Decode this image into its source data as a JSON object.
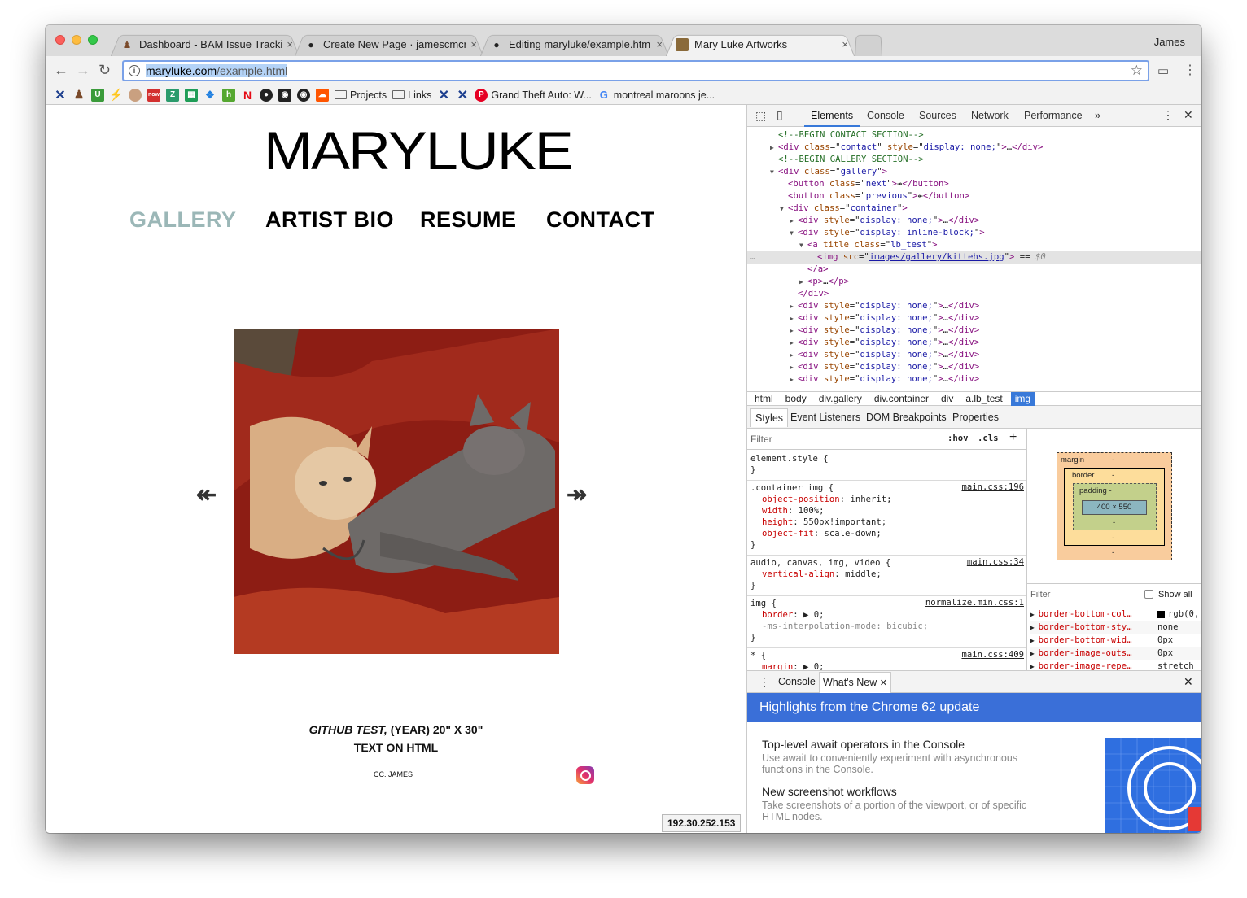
{
  "browser": {
    "user": "James",
    "tabs": [
      {
        "title": "Dashboard - BAM Issue Tracki",
        "close": "×"
      },
      {
        "title": "Create New Page · jamescmcr",
        "close": "×"
      },
      {
        "title": "Editing maryluke/example.html",
        "close": "×"
      },
      {
        "title": "Mary Luke Artworks",
        "close": "×"
      }
    ],
    "url_host": "maryluke.com",
    "url_path": "/example.html",
    "bookmarks": [
      {
        "label": "Projects"
      },
      {
        "label": "Links"
      },
      {
        "label": "Grand Theft Auto: W..."
      },
      {
        "label": "montreal maroons je..."
      }
    ]
  },
  "site": {
    "logo": "MARYLUKE",
    "nav": [
      "GALLERY",
      "ARTIST BIO",
      "RESUME",
      "CONTACT"
    ],
    "active_nav": "GALLERY",
    "active_color": "#9bb7b7",
    "prev_arrow": "↞",
    "next_arrow": "↠",
    "caption_title": "GITHUB TEST,",
    "caption_rest": " (YEAR) 20\" X 30\"",
    "caption_medium": "TEXT ON HTML",
    "credit": "CC. JAMES",
    "status_ip": "192.30.252.153"
  },
  "devtools": {
    "tabs": [
      "Elements",
      "Console",
      "Sources",
      "Network",
      "Performance",
      "»"
    ],
    "dom_lines": [
      {
        "indent": 2,
        "tri": "",
        "html": "<span class='cm'>&lt;!--BEGIN CONTACT SECTION--&gt;</span>"
      },
      {
        "indent": 2,
        "tri": "▶",
        "html": "<span class='tg'>&lt;div</span> <span class='at'>class</span>=\"<span class='av'>contact</span>\" <span class='at'>style</span>=\"<span class='av'>display: none;</span>\"<span class='tg'>&gt;</span>…<span class='tg'>&lt;/div&gt;</span>"
      },
      {
        "indent": 2,
        "tri": "",
        "html": "<span class='cm'>&lt;!--BEGIN GALLERY SECTION--&gt;</span>"
      },
      {
        "indent": 2,
        "tri": "▼",
        "html": "<span class='tg'>&lt;div</span> <span class='at'>class</span>=\"<span class='av'>gallery</span>\"<span class='tg'>&gt;</span>"
      },
      {
        "indent": 3,
        "tri": "",
        "html": "<span class='tg'>&lt;button</span> <span class='at'>class</span>=\"<span class='av'>next</span>\"<span class='tg'>&gt;</span>↠<span class='tg'>&lt;/button&gt;</span>"
      },
      {
        "indent": 3,
        "tri": "",
        "html": "<span class='tg'>&lt;button</span> <span class='at'>class</span>=\"<span class='av'>previous</span>\"<span class='tg'>&gt;</span>↞<span class='tg'>&lt;/button&gt;</span>"
      },
      {
        "indent": 3,
        "tri": "▼",
        "html": "<span class='tg'>&lt;div</span> <span class='at'>class</span>=\"<span class='av'>container</span>\"<span class='tg'>&gt;</span>"
      },
      {
        "indent": 4,
        "tri": "▶",
        "html": "<span class='tg'>&lt;div</span> <span class='at'>style</span>=\"<span class='av'>display: none;</span>\"<span class='tg'>&gt;</span>…<span class='tg'>&lt;/div&gt;</span>"
      },
      {
        "indent": 4,
        "tri": "▼",
        "html": "<span class='tg'>&lt;div</span> <span class='at'>style</span>=\"<span class='av'>display: inline-block;</span>\"<span class='tg'>&gt;</span>"
      },
      {
        "indent": 5,
        "tri": "▼",
        "html": "<span class='tg'>&lt;a</span> <span class='at'>title class</span>=\"<span class='av'>lb_test</span>\"<span class='tg'>&gt;</span>"
      },
      {
        "indent": 6,
        "tri": "",
        "sel": true,
        "html": "<span class='tg'>&lt;img</span> <span class='at'>src</span>=\"<span class='av' style='text-decoration:underline'>images/gallery/kittehs.jpg</span>\"<span class='tg'>&gt;</span> == <i style='color:#888'>$0</i>"
      },
      {
        "indent": 5,
        "tri": "",
        "html": "<span class='tg'>&lt;/a&gt;</span>"
      },
      {
        "indent": 5,
        "tri": "▶",
        "html": "<span class='tg'>&lt;p&gt;</span>…<span class='tg'>&lt;/p&gt;</span>"
      },
      {
        "indent": 4,
        "tri": "",
        "html": "<span class='tg'>&lt;/div&gt;</span>"
      },
      {
        "indent": 4,
        "tri": "▶",
        "html": "<span class='tg'>&lt;div</span> <span class='at'>style</span>=\"<span class='av'>display: none;</span>\"<span class='tg'>&gt;</span>…<span class='tg'>&lt;/div&gt;</span>"
      },
      {
        "indent": 4,
        "tri": "▶",
        "html": "<span class='tg'>&lt;div</span> <span class='at'>style</span>=\"<span class='av'>display: none;</span>\"<span class='tg'>&gt;</span>…<span class='tg'>&lt;/div&gt;</span>"
      },
      {
        "indent": 4,
        "tri": "▶",
        "html": "<span class='tg'>&lt;div</span> <span class='at'>style</span>=\"<span class='av'>display: none;</span>\"<span class='tg'>&gt;</span>…<span class='tg'>&lt;/div&gt;</span>"
      },
      {
        "indent": 4,
        "tri": "▶",
        "html": "<span class='tg'>&lt;div</span> <span class='at'>style</span>=\"<span class='av'>display: none;</span>\"<span class='tg'>&gt;</span>…<span class='tg'>&lt;/div&gt;</span>"
      },
      {
        "indent": 4,
        "tri": "▶",
        "html": "<span class='tg'>&lt;div</span> <span class='at'>style</span>=\"<span class='av'>display: none;</span>\"<span class='tg'>&gt;</span>…<span class='tg'>&lt;/div&gt;</span>"
      },
      {
        "indent": 4,
        "tri": "▶",
        "html": "<span class='tg'>&lt;div</span> <span class='at'>style</span>=\"<span class='av'>display: none;</span>\"<span class='tg'>&gt;</span>…<span class='tg'>&lt;/div&gt;</span>"
      },
      {
        "indent": 4,
        "tri": "▶",
        "html": "<span class='tg'>&lt;div</span> <span class='at'>style</span>=\"<span class='av'>display: none;</span>\"<span class='tg'>&gt;</span>…<span class='tg'>&lt;/div&gt;</span>"
      }
    ],
    "breadcrumbs": [
      "html",
      "body",
      "div.gallery",
      "div.container",
      "div",
      "a.lb_test",
      "img"
    ],
    "style_tabs": [
      "Styles",
      "Event Listeners",
      "DOM Breakpoints",
      "Properties"
    ],
    "filter_placeholder": "Filter",
    "hov": ":hov",
    "cls": ".cls",
    "rules": [
      {
        "selector": "element.style {",
        "source": "",
        "props": [],
        "close": "}"
      },
      {
        "selector": ".container img {",
        "source": "main.css:196",
        "props": [
          {
            "name": "object-position",
            "value": "inherit;"
          },
          {
            "name": "width",
            "value": "100%;"
          },
          {
            "name": "height",
            "value": "550px!important;"
          },
          {
            "name": "object-fit",
            "value": "scale-down;"
          }
        ],
        "close": "}"
      },
      {
        "selector": "audio, canvas, img, video {",
        "source": "main.css:34",
        "props": [
          {
            "name": "vertical-align",
            "value": "middle;"
          }
        ],
        "close": "}"
      },
      {
        "selector": "img {",
        "source": "normalize.min.css:1",
        "props": [
          {
            "name": "border",
            "value": "▶ 0;"
          },
          {
            "name": "-ms-interpolation-mode",
            "value": "bicubic;",
            "strike": true
          }
        ],
        "close": "}"
      },
      {
        "selector": "* {",
        "source": "main.css:409",
        "props": [
          {
            "name": "margin",
            "value": "▶ 0;"
          }
        ],
        "close": ""
      }
    ],
    "box_model": {
      "margin": "margin",
      "border": "border",
      "padding": "padding -",
      "content": "400 × 550",
      "dash": "-"
    },
    "computed_filter": "Filter",
    "show_all": "Show all",
    "computed": [
      {
        "name": "border-bottom-col…",
        "value": "rgb(0,"
      },
      {
        "name": "border-bottom-sty…",
        "value": "none"
      },
      {
        "name": "border-bottom-wid…",
        "value": "0px"
      },
      {
        "name": "border-image-outs…",
        "value": "0px"
      },
      {
        "name": "border-image-repe…",
        "value": "stretch"
      }
    ],
    "drawer_tabs": [
      "Console",
      "What's New"
    ],
    "banner": "Highlights from the Chrome 62 update",
    "news": [
      {
        "title": "Top-level await operators in the Console",
        "desc": "Use await to conveniently experiment with asynchronous functions in the Console."
      },
      {
        "title": "New screenshot workflows",
        "desc": "Take screenshots of a portion of the viewport, or of specific HTML nodes."
      }
    ]
  }
}
